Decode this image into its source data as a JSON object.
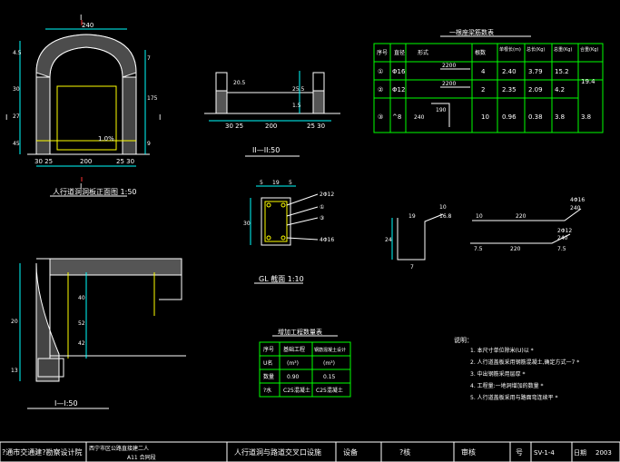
{
  "colors": {
    "bg": "#000000",
    "line": "#ffffff",
    "table": "#00ff00",
    "dim": "#00ffff",
    "section": "#ff3030",
    "text": "#ffff00"
  },
  "arch": {
    "title": "人行道洞洞板正面图 1:50",
    "top_width": "240",
    "bottom_dims": [
      "30 25",
      "200",
      "25 30"
    ],
    "slope": "1.0%",
    "section_mark": "I",
    "left_dims": [
      "4.5",
      "30",
      "27",
      "45"
    ],
    "right_dims": [
      "7",
      "175",
      "9"
    ]
  },
  "section2": {
    "title": "II—II:50",
    "dims": [
      "20.5",
      "25.5",
      "1.5"
    ],
    "bottom_dims": [
      "30 25",
      "200",
      "25 30"
    ]
  },
  "section1": {
    "title": "I—I:50",
    "dims": [
      "40",
      "52",
      "42",
      "20",
      "13"
    ]
  },
  "gl_section": {
    "title": "GL 截面 1:10",
    "top_dims": [
      "5",
      "19",
      "5"
    ],
    "left_dim": "30",
    "bar_labels": [
      "2Φ12",
      "①",
      "③",
      "4Φ16"
    ]
  },
  "bar_shapes": {
    "shape1_dims": [
      "19",
      "24",
      "7",
      "10",
      "16.8"
    ],
    "shape2_dims": [
      "10",
      "220",
      "4Φ16",
      "240"
    ],
    "shape3_dims": [
      "7.5",
      "220",
      "7.5",
      "2Φ12",
      "240"
    ]
  },
  "rebar_table": {
    "title": "一根座梁筋数表",
    "headers": [
      "序号",
      "直径",
      "形式",
      "根数",
      "单根长(m)",
      "总长(Kg)",
      "总重(Kg)",
      "合重(Kg)"
    ],
    "rows": [
      {
        "no": "①",
        "dia": "Φ16",
        "shape_len": "2200",
        "count": "4",
        "unit_len": "2.40",
        "total_len": "3.79",
        "weight": "15.2"
      },
      {
        "no": "②",
        "dia": "Φ12",
        "shape_len": "2200",
        "count": "2",
        "unit_len": "2.35",
        "total_len": "2.09",
        "weight": "4.2"
      },
      {
        "no": "③",
        "dia": "^8",
        "shape_len": "190",
        "shape_len2": "240",
        "count": "10",
        "unit_len": "0.96",
        "total_len": "0.38",
        "weight": "3.8",
        "total": "3.8"
      }
    ],
    "merged_total": "19.4"
  },
  "qty_table": {
    "title": "增加工程数量表",
    "headers": [
      "序号",
      "基础工程",
      "钢筋混凝土设计"
    ],
    "rows": [
      [
        "U名",
        "(m³)",
        "(m³)"
      ],
      [
        "数量",
        "0.90",
        "0.15"
      ],
      [
        "?水",
        "C25混凝土",
        "C25混凝土"
      ]
    ]
  },
  "notes": {
    "title": "说明：",
    "items": [
      "1.   本尺寸单位除米(U)以 *",
      "2.   人行道盖板采用钢筋混凝土,确定方式一7 *",
      "3.   中出钢筋采用层厚 *",
      "4.   工程量:一地洞增加的数量 *",
      "5.   人行道盖板采用与路面弯连续平 *"
    ]
  },
  "title_block": {
    "company": "?通市交通建?勘察设计院",
    "project": "西宁市区公路直接建二人",
    "project2": "A11   合同段",
    "drawing_title": "人行道洞与路道交叉口设施",
    "designer_label": "设备",
    "reviewer_label": "?核",
    "approver_label": "审核",
    "number_label": "号",
    "number": "SV-1-4",
    "date_label": "日期",
    "date": "2003"
  }
}
